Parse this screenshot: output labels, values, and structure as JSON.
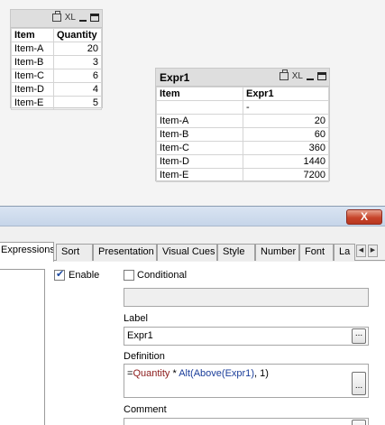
{
  "table_box1": {
    "headers": [
      "Item",
      "Quantity"
    ],
    "rows": [
      [
        "Item-A",
        "20"
      ],
      [
        "Item-B",
        "3"
      ],
      [
        "Item-C",
        "6"
      ],
      [
        "Item-D",
        "4"
      ],
      [
        "Item-E",
        "5"
      ]
    ],
    "xl_label": "XL"
  },
  "table_box2": {
    "caption": "Expr1",
    "xl_label": "XL",
    "headers": [
      "Item",
      "Expr1"
    ],
    "total_row": [
      "",
      "-"
    ],
    "rows": [
      [
        "Item-A",
        "20"
      ],
      [
        "Item-B",
        "60"
      ],
      [
        "Item-C",
        "360"
      ],
      [
        "Item-D",
        "1440"
      ],
      [
        "Item-E",
        "7200"
      ]
    ]
  },
  "dialog": {
    "close_label": "X",
    "tabs": [
      "Expressions",
      "Sort",
      "Presentation",
      "Visual Cues",
      "Style",
      "Number",
      "Font",
      "La"
    ],
    "active_tab": "Expressions",
    "enable_label": "Enable",
    "conditional_label": "Conditional",
    "label_caption": "Label",
    "label_value": "Expr1",
    "definition_caption": "Definition",
    "definition_parts": {
      "eq": "=",
      "field": "Quantity",
      "op": " * ",
      "fn1": "Alt(",
      "fn2": "Above(",
      "arg": "Expr1",
      "close1": ")",
      "sep": ", 1)"
    },
    "comment_caption": "Comment",
    "dots_label": "..."
  }
}
